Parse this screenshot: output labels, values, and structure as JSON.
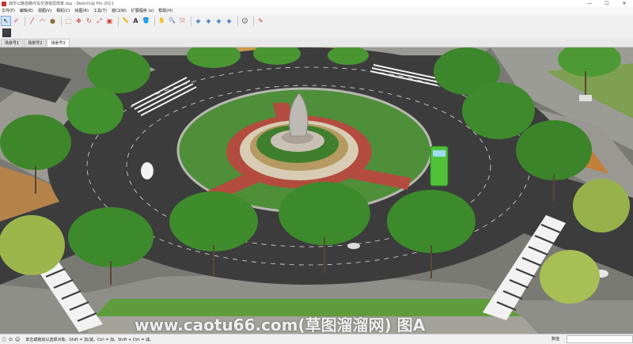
{
  "window": {
    "title": "城市公路道路环岛交通枢纽场景.skp - SketchUp Pro 2021",
    "controls": [
      "—",
      "☐",
      "✕"
    ]
  },
  "menu": [
    "文件(F)",
    "编辑(E)",
    "视图(V)",
    "相机(C)",
    "绘图(R)",
    "工具(T)",
    "窗口(W)",
    "扩展程序 (x)",
    "帮助(H)"
  ],
  "toolbar": {
    "icons": [
      {
        "name": "select-tool-icon",
        "glyph": "↖"
      },
      {
        "name": "eraser-tool-icon",
        "glyph": "✐"
      },
      {
        "name": "line-tool-icon",
        "glyph": "╱"
      },
      {
        "name": "arc-tool-icon",
        "glyph": "◠"
      },
      {
        "name": "shape-tool-icon",
        "glyph": "●"
      },
      {
        "name": "push-pull-tool-icon",
        "glyph": "⬚"
      },
      {
        "name": "move-tool-icon",
        "glyph": "✥"
      },
      {
        "name": "rotate-tool-icon",
        "glyph": "↻"
      },
      {
        "name": "scale-tool-icon",
        "glyph": "⤢"
      },
      {
        "name": "offset-tool-icon",
        "glyph": "▣"
      },
      {
        "name": "tape-measure-icon",
        "glyph": "📏"
      },
      {
        "name": "text-tool-icon",
        "glyph": "A"
      },
      {
        "name": "paint-bucket-icon",
        "glyph": "🪣"
      },
      {
        "name": "orbit-tool-icon",
        "glyph": "✋"
      },
      {
        "name": "zoom-tool-icon",
        "glyph": "🔍"
      },
      {
        "name": "zoom-extents-icon",
        "glyph": "⤧"
      },
      {
        "name": "warehouse-icon",
        "glyph": "◈"
      },
      {
        "name": "extension-warehouse-icon",
        "glyph": "◈"
      },
      {
        "name": "layout-icon",
        "glyph": "◈"
      },
      {
        "name": "styles-icon",
        "glyph": "◈"
      },
      {
        "name": "account-icon",
        "glyph": "☺"
      },
      {
        "name": "edit-note-icon",
        "glyph": "✎"
      }
    ]
  },
  "tabs": [
    "场景号1",
    "场景号2",
    "场景号3"
  ],
  "active_tab": 2,
  "status": {
    "hint": "单击或拖动以选择对象。Shift = 加/减。Ctrl = 加。Shift + Ctrl = 减。",
    "measurements_label": "数值"
  },
  "watermark": "www.caotu66.com(草图溜溜网) 图A"
}
